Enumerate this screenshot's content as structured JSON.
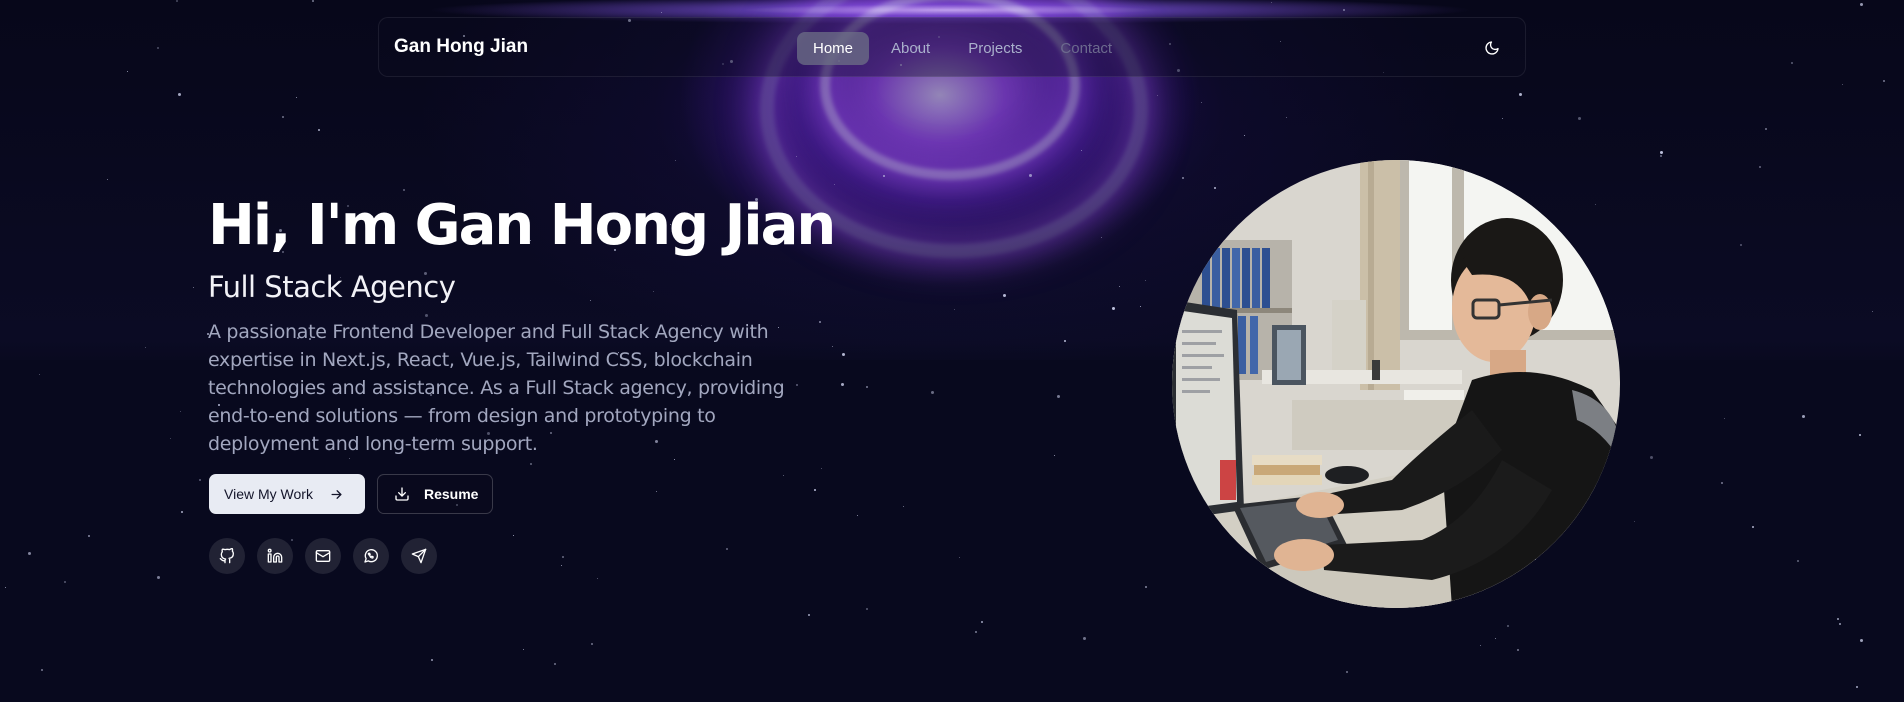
{
  "nav": {
    "brand": "Gan Hong Jian",
    "links": [
      {
        "label": "Home",
        "active": true
      },
      {
        "label": "About",
        "active": false
      },
      {
        "label": "Projects",
        "active": false
      },
      {
        "label": "Contact",
        "active": false
      }
    ],
    "theme_toggle_icon": "moon-icon"
  },
  "hero": {
    "title": "Hi, I'm Gan Hong Jian",
    "subtitle": "Full Stack Agency",
    "description": "A passionate Frontend Developer and Full Stack Agency with expertise in Next.js, React, Vue.js, Tailwind CSS, blockchain technologies and assistance. As a Full Stack agency, providing end-to-end solutions — from design and prototyping to deployment and long-term support."
  },
  "buttons": {
    "primary": {
      "label": "View My Work",
      "icon": "arrow-right-icon"
    },
    "secondary": {
      "label": "Resume",
      "icon": "download-icon"
    }
  },
  "socials": [
    {
      "icon": "github-icon"
    },
    {
      "icon": "linkedin-icon"
    },
    {
      "icon": "mail-icon"
    },
    {
      "icon": "whatsapp-icon"
    },
    {
      "icon": "telegram-icon"
    }
  ],
  "colors": {
    "background": "#0a0a1f",
    "accent_glow": "#8b5cf6",
    "primary_button": "#e8ebf3"
  }
}
